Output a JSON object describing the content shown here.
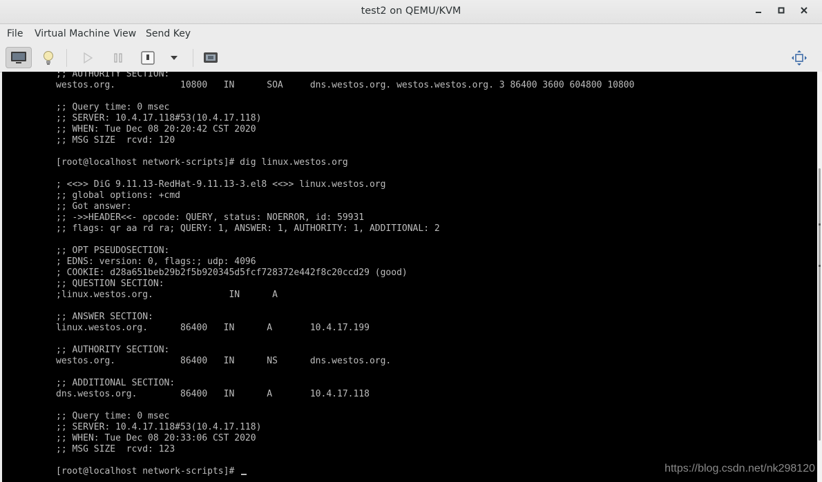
{
  "window": {
    "title": "test2 on QEMU/KVM",
    "minimize_icon": "minimize-icon",
    "maximize_icon": "maximize-icon",
    "close_icon": "close-icon"
  },
  "menu": {
    "items": [
      "File",
      "Virtual Machine",
      "View",
      "Send Key"
    ]
  },
  "toolbar": {
    "icons": [
      "monitor-icon",
      "lightbulb-icon",
      "play-icon",
      "pause-icon",
      "power-icon",
      "dropdown-arrow-icon",
      "screenshot-icon",
      "fullscreen-icon"
    ]
  },
  "console": {
    "lines": [
      ";; AUTHORITY SECTION:",
      "westos.org.            10800   IN      SOA     dns.westos.org. westos.westos.org. 3 86400 3600 604800 10800",
      "",
      ";; Query time: 0 msec",
      ";; SERVER: 10.4.17.118#53(10.4.17.118)",
      ";; WHEN: Tue Dec 08 20:20:42 CST 2020",
      ";; MSG SIZE  rcvd: 120",
      "",
      "[root@localhost network-scripts]# dig linux.westos.org",
      "",
      "; <<>> DiG 9.11.13-RedHat-9.11.13-3.el8 <<>> linux.westos.org",
      ";; global options: +cmd",
      ";; Got answer:",
      ";; ->>HEADER<<- opcode: QUERY, status: NOERROR, id: 59931",
      ";; flags: qr aa rd ra; QUERY: 1, ANSWER: 1, AUTHORITY: 1, ADDITIONAL: 2",
      "",
      ";; OPT PSEUDOSECTION:",
      "; EDNS: version: 0, flags:; udp: 4096",
      "; COOKIE: d28a651beb29b2f5b920345d5fcf728372e442f8c20ccd29 (good)",
      ";; QUESTION SECTION:",
      ";linux.westos.org.              IN      A",
      "",
      ";; ANSWER SECTION:",
      "linux.westos.org.      86400   IN      A       10.4.17.199",
      "",
      ";; AUTHORITY SECTION:",
      "westos.org.            86400   IN      NS      dns.westos.org.",
      "",
      ";; ADDITIONAL SECTION:",
      "dns.westos.org.        86400   IN      A       10.4.17.118",
      "",
      ";; Query time: 0 msec",
      ";; SERVER: 10.4.17.118#53(10.4.17.118)",
      ";; WHEN: Tue Dec 08 20:33:06 CST 2020",
      ";; MSG SIZE  rcvd: 123",
      "",
      "[root@localhost network-scripts]# "
    ]
  },
  "watermark": "https://blog.csdn.net/nk298120"
}
